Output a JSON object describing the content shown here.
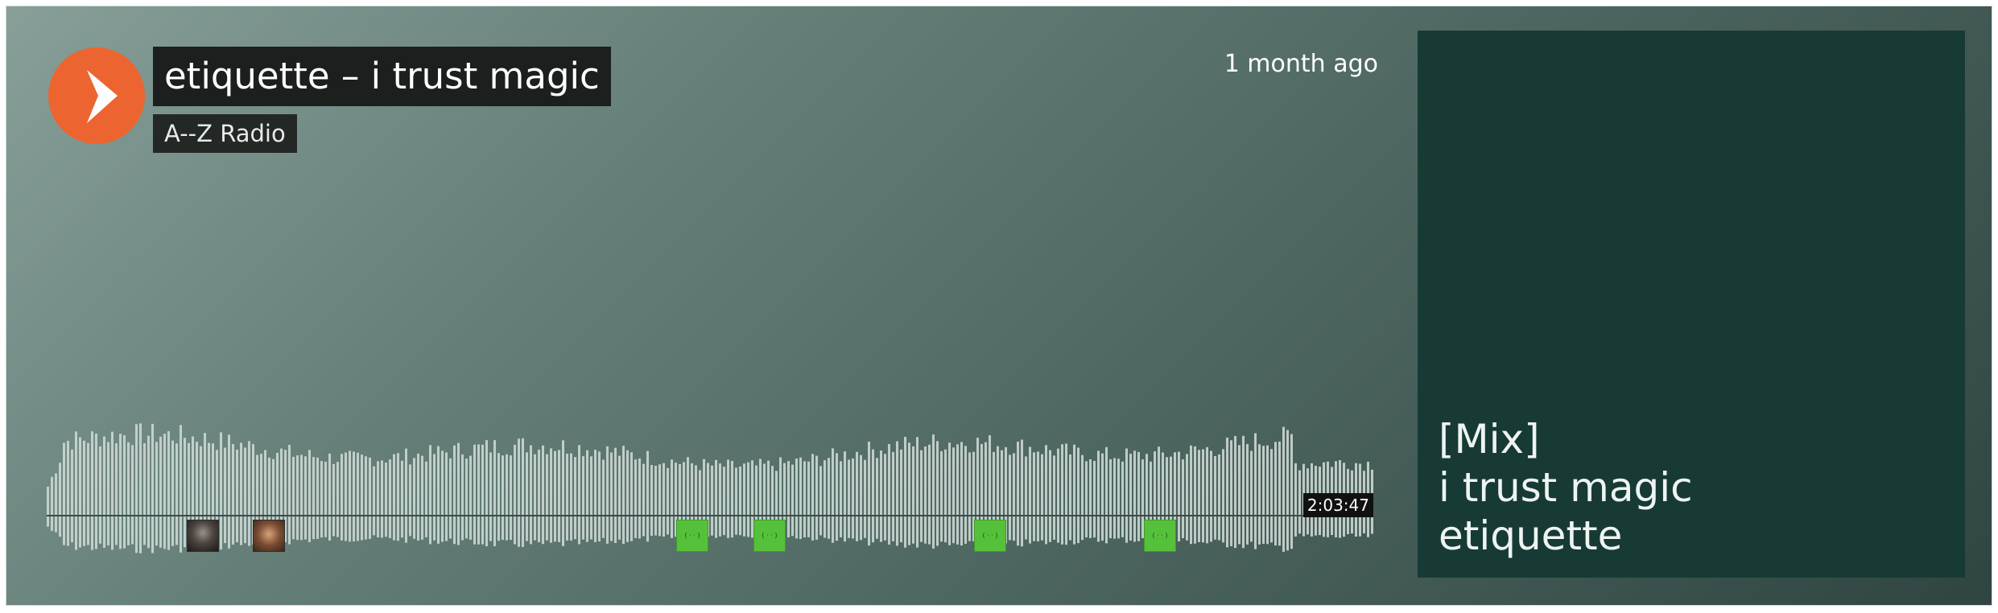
{
  "colors": {
    "accent": "#ec6530",
    "artwork_bg": "#173a35",
    "comment_green": "#55c13a",
    "wave_bar": "#ccd7d3"
  },
  "player": {
    "play_icon": "play-icon",
    "title": "etiquette – i trust magic",
    "artist": "A--Z Radio",
    "uploaded": "1 month ago",
    "duration": "2:03:47"
  },
  "artwork": {
    "line1": "[Mix]",
    "line2": "i trust magic",
    "line3": "etiquette"
  },
  "comments": {
    "icons": [
      "commenter-avatar-icon",
      "commenter-avatar-icon",
      "default-avatar-icon",
      "default-avatar-icon",
      "default-avatar-icon",
      "default-avatar-icon"
    ]
  }
}
